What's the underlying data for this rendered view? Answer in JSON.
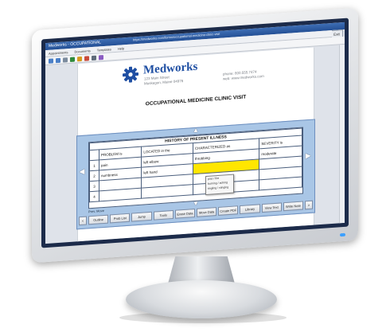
{
  "window": {
    "title": "Medworks - OCCUPATIONAL",
    "address": "https://medworks.com/forms/occupational-medicine-clinic-visit",
    "exit_label": "Exit"
  },
  "menu": [
    "Appointments",
    "Documents",
    "Templates",
    "Help"
  ],
  "toolbar_icons": [
    "back-icon",
    "forward-icon",
    "print-icon",
    "save-icon",
    "zoom-icon",
    "search-icon",
    "camera-icon",
    "settings-icon"
  ],
  "document": {
    "brand": "Medworks",
    "address_line1": "123 Main Street",
    "address_line2": "Muskegon, Maine 04976",
    "phone": "phone: 800.555.7474",
    "web": "web:   www.medworks.com",
    "title": "OCCUPATIONAL MEDICINE CLINIC VISIT"
  },
  "hpi": {
    "title": "HISTORY OF PRESENT ILLNESS",
    "columns": [
      "PROBLEM is",
      "LOCATED in the",
      "CHARACTERIZED as",
      "SEVERITY is"
    ],
    "rows": [
      {
        "num": "1",
        "problem": "pain",
        "location": "left elbow",
        "character": "throbbing",
        "severity": "moderate"
      },
      {
        "num": "2",
        "problem": "numbness",
        "location": "left hand",
        "character": "",
        "severity": ""
      },
      {
        "num": "3",
        "problem": "",
        "location": "",
        "character": "",
        "severity": ""
      },
      {
        "num": "4",
        "problem": "",
        "location": "",
        "character": "",
        "severity": ""
      }
    ],
    "popup_options": [
      "pins / fire",
      "burning / aching",
      "tingling / stinging"
    ],
    "more_label": "Prev. Move",
    "buttons": [
      "Outline",
      "Prob List",
      "Jump",
      "Tools",
      "Erase Data",
      "Move Data",
      "Create PDF",
      "Library",
      "View Text",
      "Write Note"
    ]
  },
  "colors": {
    "brand": "#1f4fa3",
    "panel": "#a9c6e6",
    "highlight": "#ffe600",
    "bezel": "#1c2b4a"
  }
}
